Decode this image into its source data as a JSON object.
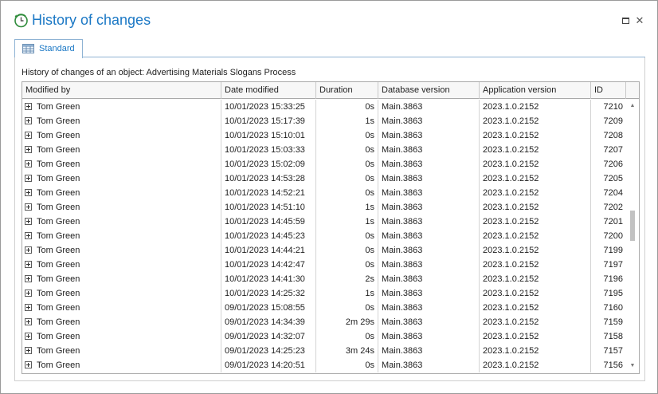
{
  "window": {
    "title": "History of changes",
    "accent_color": "#1b78c5",
    "icons": {
      "app": "clock-history-icon",
      "maximize": "maximize-icon",
      "close": "close-icon"
    },
    "close_glyph": "✕"
  },
  "tabs": [
    {
      "label": "Standard",
      "icon": "table-icon",
      "active": true
    }
  ],
  "caption": "History of changes of an object: Advertising Materials  Slogans Process",
  "grid": {
    "columns": [
      "Modified by",
      "Date modified",
      "Duration",
      "Database version",
      "Application version",
      "ID"
    ],
    "rows": [
      {
        "modified_by": "Tom Green",
        "date": "10/01/2023 15:33:25",
        "duration": "0s",
        "db": "Main.3863",
        "app": "2023.1.0.2152",
        "id": "7210"
      },
      {
        "modified_by": "Tom Green",
        "date": "10/01/2023 15:17:39",
        "duration": "1s",
        "db": "Main.3863",
        "app": "2023.1.0.2152",
        "id": "7209"
      },
      {
        "modified_by": "Tom Green",
        "date": "10/01/2023 15:10:01",
        "duration": "0s",
        "db": "Main.3863",
        "app": "2023.1.0.2152",
        "id": "7208"
      },
      {
        "modified_by": "Tom Green",
        "date": "10/01/2023 15:03:33",
        "duration": "0s",
        "db": "Main.3863",
        "app": "2023.1.0.2152",
        "id": "7207"
      },
      {
        "modified_by": "Tom Green",
        "date": "10/01/2023 15:02:09",
        "duration": "0s",
        "db": "Main.3863",
        "app": "2023.1.0.2152",
        "id": "7206"
      },
      {
        "modified_by": "Tom Green",
        "date": "10/01/2023 14:53:28",
        "duration": "0s",
        "db": "Main.3863",
        "app": "2023.1.0.2152",
        "id": "7205"
      },
      {
        "modified_by": "Tom Green",
        "date": "10/01/2023 14:52:21",
        "duration": "0s",
        "db": "Main.3863",
        "app": "2023.1.0.2152",
        "id": "7204"
      },
      {
        "modified_by": "Tom Green",
        "date": "10/01/2023 14:51:10",
        "duration": "1s",
        "db": "Main.3863",
        "app": "2023.1.0.2152",
        "id": "7202"
      },
      {
        "modified_by": "Tom Green",
        "date": "10/01/2023 14:45:59",
        "duration": "1s",
        "db": "Main.3863",
        "app": "2023.1.0.2152",
        "id": "7201"
      },
      {
        "modified_by": "Tom Green",
        "date": "10/01/2023 14:45:23",
        "duration": "0s",
        "db": "Main.3863",
        "app": "2023.1.0.2152",
        "id": "7200"
      },
      {
        "modified_by": "Tom Green",
        "date": "10/01/2023 14:44:21",
        "duration": "0s",
        "db": "Main.3863",
        "app": "2023.1.0.2152",
        "id": "7199"
      },
      {
        "modified_by": "Tom Green",
        "date": "10/01/2023 14:42:47",
        "duration": "0s",
        "db": "Main.3863",
        "app": "2023.1.0.2152",
        "id": "7197"
      },
      {
        "modified_by": "Tom Green",
        "date": "10/01/2023 14:41:30",
        "duration": "2s",
        "db": "Main.3863",
        "app": "2023.1.0.2152",
        "id": "7196"
      },
      {
        "modified_by": "Tom Green",
        "date": "10/01/2023 14:25:32",
        "duration": "1s",
        "db": "Main.3863",
        "app": "2023.1.0.2152",
        "id": "7195"
      },
      {
        "modified_by": "Tom Green",
        "date": "09/01/2023 15:08:55",
        "duration": "0s",
        "db": "Main.3863",
        "app": "2023.1.0.2152",
        "id": "7160"
      },
      {
        "modified_by": "Tom Green",
        "date": "09/01/2023 14:34:39",
        "duration": "2m 29s",
        "db": "Main.3863",
        "app": "2023.1.0.2152",
        "id": "7159"
      },
      {
        "modified_by": "Tom Green",
        "date": "09/01/2023 14:32:07",
        "duration": "0s",
        "db": "Main.3863",
        "app": "2023.1.0.2152",
        "id": "7158"
      },
      {
        "modified_by": "Tom Green",
        "date": "09/01/2023 14:25:23",
        "duration": "3m 24s",
        "db": "Main.3863",
        "app": "2023.1.0.2152",
        "id": "7157"
      },
      {
        "modified_by": "Tom Green",
        "date": "09/01/2023 14:20:51",
        "duration": "0s",
        "db": "Main.3863",
        "app": "2023.1.0.2152",
        "id": "7156"
      }
    ],
    "scroll": {
      "up_glyph": "▲",
      "down_glyph": "▼"
    }
  }
}
